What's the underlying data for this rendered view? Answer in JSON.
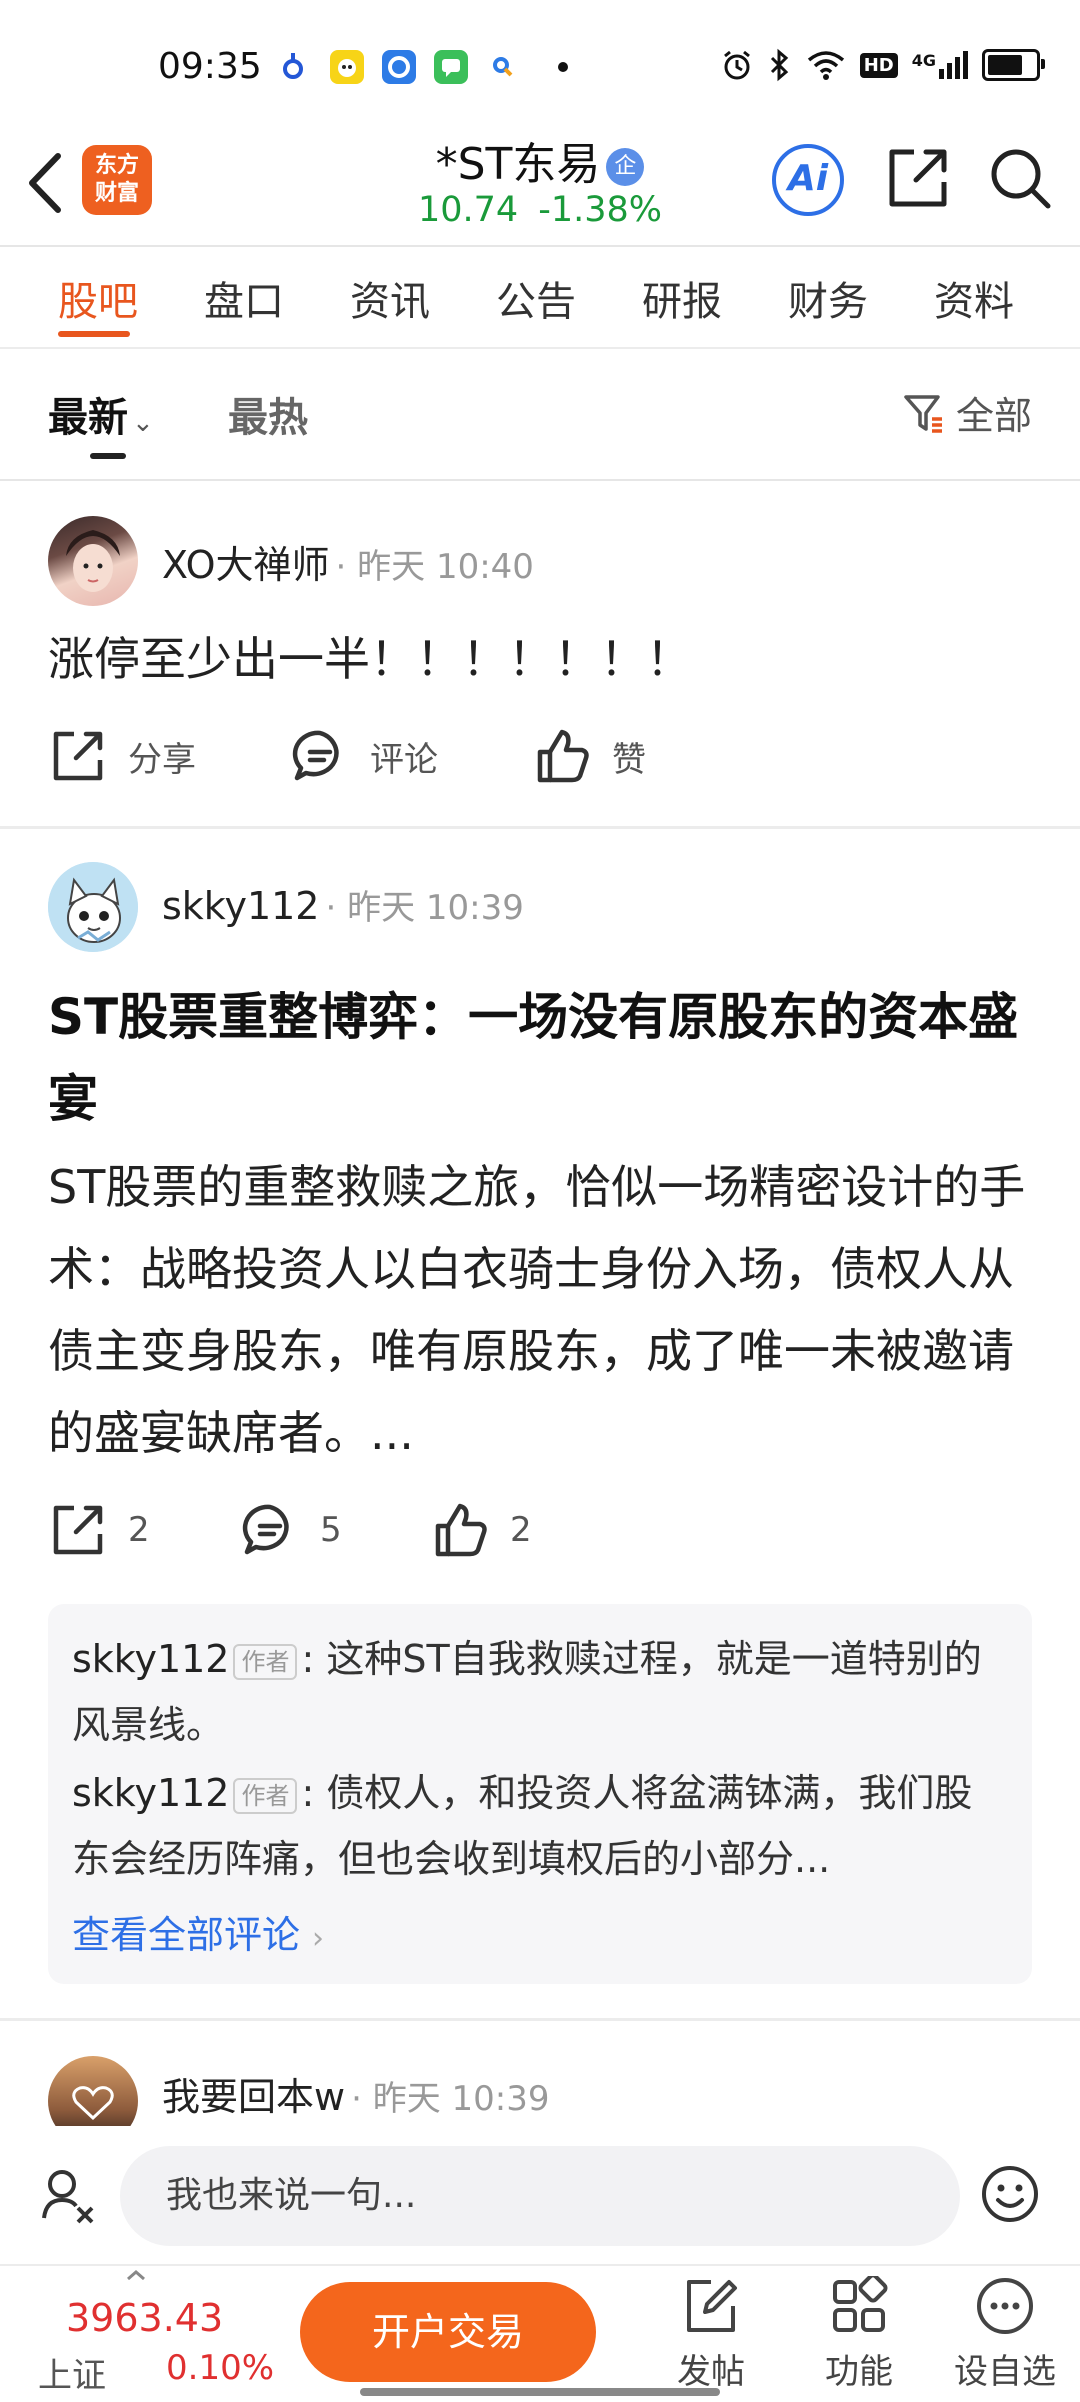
{
  "status_bar": {
    "time": "09:35",
    "app_icons": [
      "baidu-icon",
      "app-yellow-icon",
      "browser-icon",
      "messages-icon",
      "search-app-icon"
    ],
    "right_icons": [
      "alarm-icon",
      "bluetooth-icon",
      "wifi-icon",
      "hd-icon",
      "signal-4g-icon",
      "battery-icon"
    ],
    "hd_label": "HD",
    "network": "4G",
    "battery_level": 0.85
  },
  "header": {
    "logo_text_line1": "东方",
    "logo_text_line2": "财富",
    "stock_name": "*ST东易",
    "verified_label": "企",
    "price": "10.74",
    "change_percent": "-1.38%",
    "ai_label": "Ai"
  },
  "tabs": [
    "股吧",
    "盘口",
    "资讯",
    "公告",
    "研报",
    "财务",
    "资料"
  ],
  "filter": {
    "sort_newest": "最新",
    "sort_hot": "最热",
    "filter_all": "全部"
  },
  "posts": [
    {
      "author": "XO大禅师",
      "meta": "· 昨天 10:40",
      "text": "涨停至少出一半！！！！！！！",
      "actions": {
        "share": "分享",
        "comment": "评论",
        "like": "赞"
      }
    },
    {
      "author": "skky112",
      "meta": "· 昨天 10:39",
      "title": "ST股票重整博弈：一场没有原股东的资本盛宴",
      "body": "ST股票的重整救赎之旅，恰似一场精密设计的手术：战略投资人以白衣骑士身份入场，债权人从债主变身股东，唯有原股东，成了唯一未被邀请的盛宴缺席者。...",
      "actions": {
        "share": "2",
        "comment": "5",
        "like": "2"
      },
      "comments": [
        {
          "user": "skky112",
          "badge": "作者",
          "text": ": 这种ST自我救赎过程，就是一道特别的风景线。"
        },
        {
          "user": "skky112",
          "badge": "作者",
          "text": ": 债权人，和投资人将盆满钵满，我们股东会经历阵痛，但也会收到填权后的小部分..."
        }
      ],
      "view_all": "查看全部评论"
    },
    {
      "author": "我要回本w",
      "meta": "· 昨天 10:39"
    }
  ],
  "comment_input": {
    "placeholder": "我也来说一句..."
  },
  "bottom_bar": {
    "index_value": "3963.43",
    "index_name": "上证",
    "index_change": "0.10%",
    "trade_button": "开户交易",
    "nav": [
      "发帖",
      "功能",
      "设自选"
    ]
  },
  "colors": {
    "accent_orange": "#e8561e",
    "price_green": "#1a9a3a",
    "index_red": "#e03030",
    "link_blue": "#2d6fe6"
  }
}
